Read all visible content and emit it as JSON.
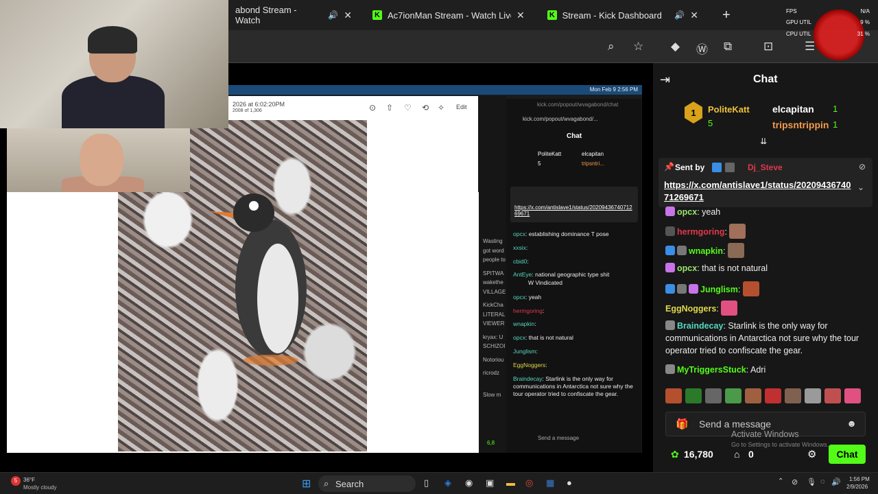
{
  "browser": {
    "tabs": [
      {
        "label": "abond Stream - Watch",
        "logo": ""
      },
      {
        "label": "Ac7ionMan Stream - Watch Live",
        "logo": "K"
      },
      {
        "label": "Stream - Kick Dashboard",
        "logo": "K"
      }
    ],
    "new_tab": "+"
  },
  "perf": {
    "fps_label": "FPS",
    "fps_value": "N/A",
    "gpu_label": "GPU UTIL",
    "gpu_value": "9 %",
    "cpu_label": "CPU UTIL",
    "cpu_value": "31 %"
  },
  "mac": {
    "time": "Mon Feb 9  2:56 PM",
    "photo_date": "2026 at 6:02:20PM",
    "photo_count": "2008 of 1,306",
    "edit_label": "Edit",
    "popout_url": "kick.com/popout/wvagabond/chat",
    "popout_url2": "kick.com/popout/wvagabond/...",
    "popout_title": "Chat",
    "popout_top1": "PoliteKatt",
    "popout_top1_count": "5",
    "popout_top2": "elcapitan",
    "popout_top3": "tripsntri...",
    "popout_link": "https://x.com/antislave1/status/2020943674071269671",
    "popout_msgs": [
      {
        "user": "opcx",
        "text": ": establishing dominance T pose"
      },
      {
        "user": "xxsix",
        "text": ":"
      },
      {
        "user": "cbid0",
        "text": ":"
      },
      {
        "user": "AntEye",
        "text": ": national geographic type shit"
      },
      {
        "user": "",
        "text": "W Vindicated"
      },
      {
        "user": "opcx",
        "text": ": yeah"
      },
      {
        "user": "hermgoring",
        "text": ":"
      },
      {
        "user": "wnapkin",
        "text": ":"
      },
      {
        "user": "opcx",
        "text": ": that is not natural"
      },
      {
        "user": "Junglism",
        "text": ":"
      },
      {
        "user": "EggNoggers",
        "text": ":"
      },
      {
        "user": "Braindecay",
        "text": ": Starlink is the only way for communications in Antarctica not sure why the tour operator tried to confiscate the gear."
      }
    ],
    "popout_input": "Send a message",
    "popout_points": "6,8",
    "sliver": [
      "Wasting",
      "got word",
      "people to",
      "SPITWA",
      "wakethe",
      "VILLAGE",
      "KickCha",
      "LITERAL",
      "VIEWER",
      "kryax: U",
      "SCHIZOI",
      "Notoriou",
      "ricrodz",
      "Slow m"
    ]
  },
  "chat": {
    "title": "Chat",
    "top1": {
      "name": "PoliteKatt",
      "count": "5"
    },
    "top2": {
      "name": "elcapitan",
      "count": "1"
    },
    "top3": {
      "name": "tripsntrippin",
      "count": "1"
    },
    "pinned_label": "Sent by",
    "pinned_user": "Dj_Steve",
    "pinned_link": "https://x.com/antislave1/status/2020943674071269671",
    "messages": [
      {
        "user": "opcx",
        "text": ": yeah",
        "color": "#9ae66e"
      },
      {
        "user": "hermgoring",
        "text": ":",
        "color": "#e0384a"
      },
      {
        "user": "wnapkin",
        "text": ":",
        "color": "#53fc18"
      },
      {
        "user": "opcx",
        "text": ": that is not natural",
        "color": "#9ae66e"
      },
      {
        "user": "Junglism",
        "text": ":",
        "color": "#53fc18"
      },
      {
        "user": "EggNoggers",
        "text": ":",
        "color": "#e0d84a"
      },
      {
        "user": "Braindecay",
        "text": ": Starlink is the only way for communications in Antarctica not sure why the tour operator tried to confiscate the gear.",
        "color": "#55d8c1"
      },
      {
        "user": "MyTriggersStuck",
        "text": ": Adri",
        "color": "#53fc18"
      }
    ],
    "input_placeholder": "Send a message",
    "points": "16,780",
    "gifts": "0",
    "chat_button": "Chat",
    "watermark1": "Activate Windows",
    "watermark2": "Go to Settings to activate Windows."
  },
  "taskbar": {
    "weather_temp": "36°F",
    "weather_desc": "Mostly cloudy",
    "search": "Search",
    "time": "1:56 PM",
    "date": "2/9/2026"
  },
  "colors": {
    "kick_green": "#53fc18",
    "chat_bg": "#171717",
    "link": "#ffffff"
  }
}
